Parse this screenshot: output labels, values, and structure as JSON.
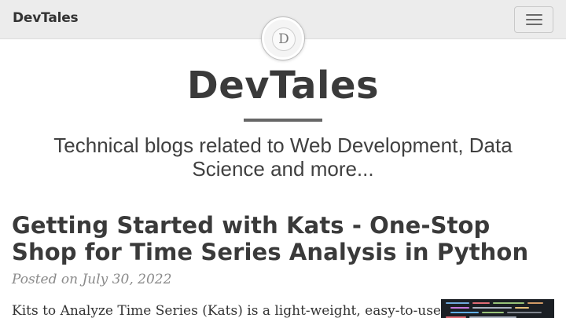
{
  "navbar": {
    "brand": "DevTales",
    "menu_toggle_icon": "hamburger-menu-icon"
  },
  "header": {
    "avatar_letter": "D",
    "site_title": "DevTales",
    "tagline": "Technical blogs related to Web Development, Data Science and more..."
  },
  "post": {
    "title": "Getting Started with Kats - One-Stop Shop for Time Series Analysis in Python",
    "meta": "Posted on July 30, 2022",
    "excerpt": "Kits to Analyze Time Series (Kats) is a light-weight, easy-to-use,",
    "thumbnail_icon": "code-screenshot-thumbnail"
  },
  "colors": {
    "navbar_bg": "#ececec",
    "title_text": "#3a3a3a",
    "meta_text": "#8a8a8a",
    "divider": "#666666"
  }
}
